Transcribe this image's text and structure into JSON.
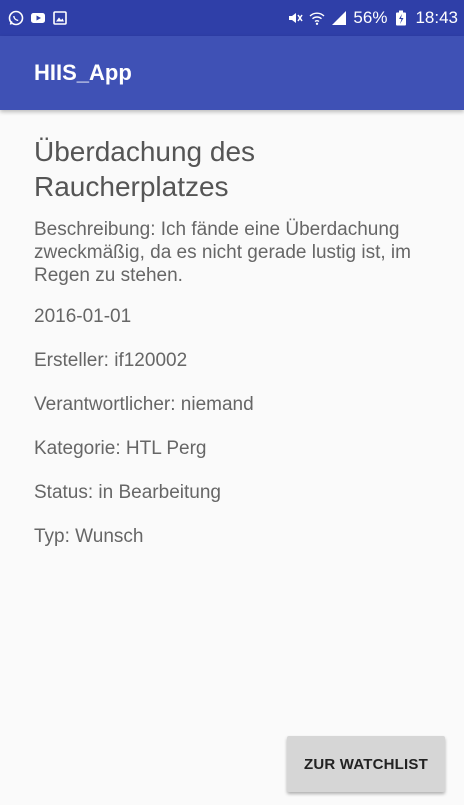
{
  "status_bar": {
    "left_icons": [
      "whatsapp-icon",
      "youtube-icon",
      "gallery-icon"
    ],
    "right_icons": [
      "mute-icon",
      "wifi-icon",
      "signal-icon",
      "battery-icon"
    ],
    "battery": "56%",
    "time": "18:43"
  },
  "app_bar": {
    "title": "HIIS_App"
  },
  "detail": {
    "title": "Überdachung des Raucherplatzes",
    "description": "Beschreibung: Ich fände eine Überdachung zweckmäßig, da es nicht gerade lustig ist, im Regen zu stehen.",
    "date": "2016-01-01",
    "creator": "Ersteller: if120002",
    "responsible": "Verantwortlicher: niemand",
    "category": "Kategorie: HTL Perg",
    "status": "Status: in Bearbeitung",
    "type": "Typ: Wunsch"
  },
  "actions": {
    "watchlist_label": "ZUR WATCHLIST"
  },
  "colors": {
    "status_bar": "#2f3fa8",
    "app_bar": "#3f51b5",
    "background": "#fafafa",
    "button": "#d6d6d6"
  }
}
